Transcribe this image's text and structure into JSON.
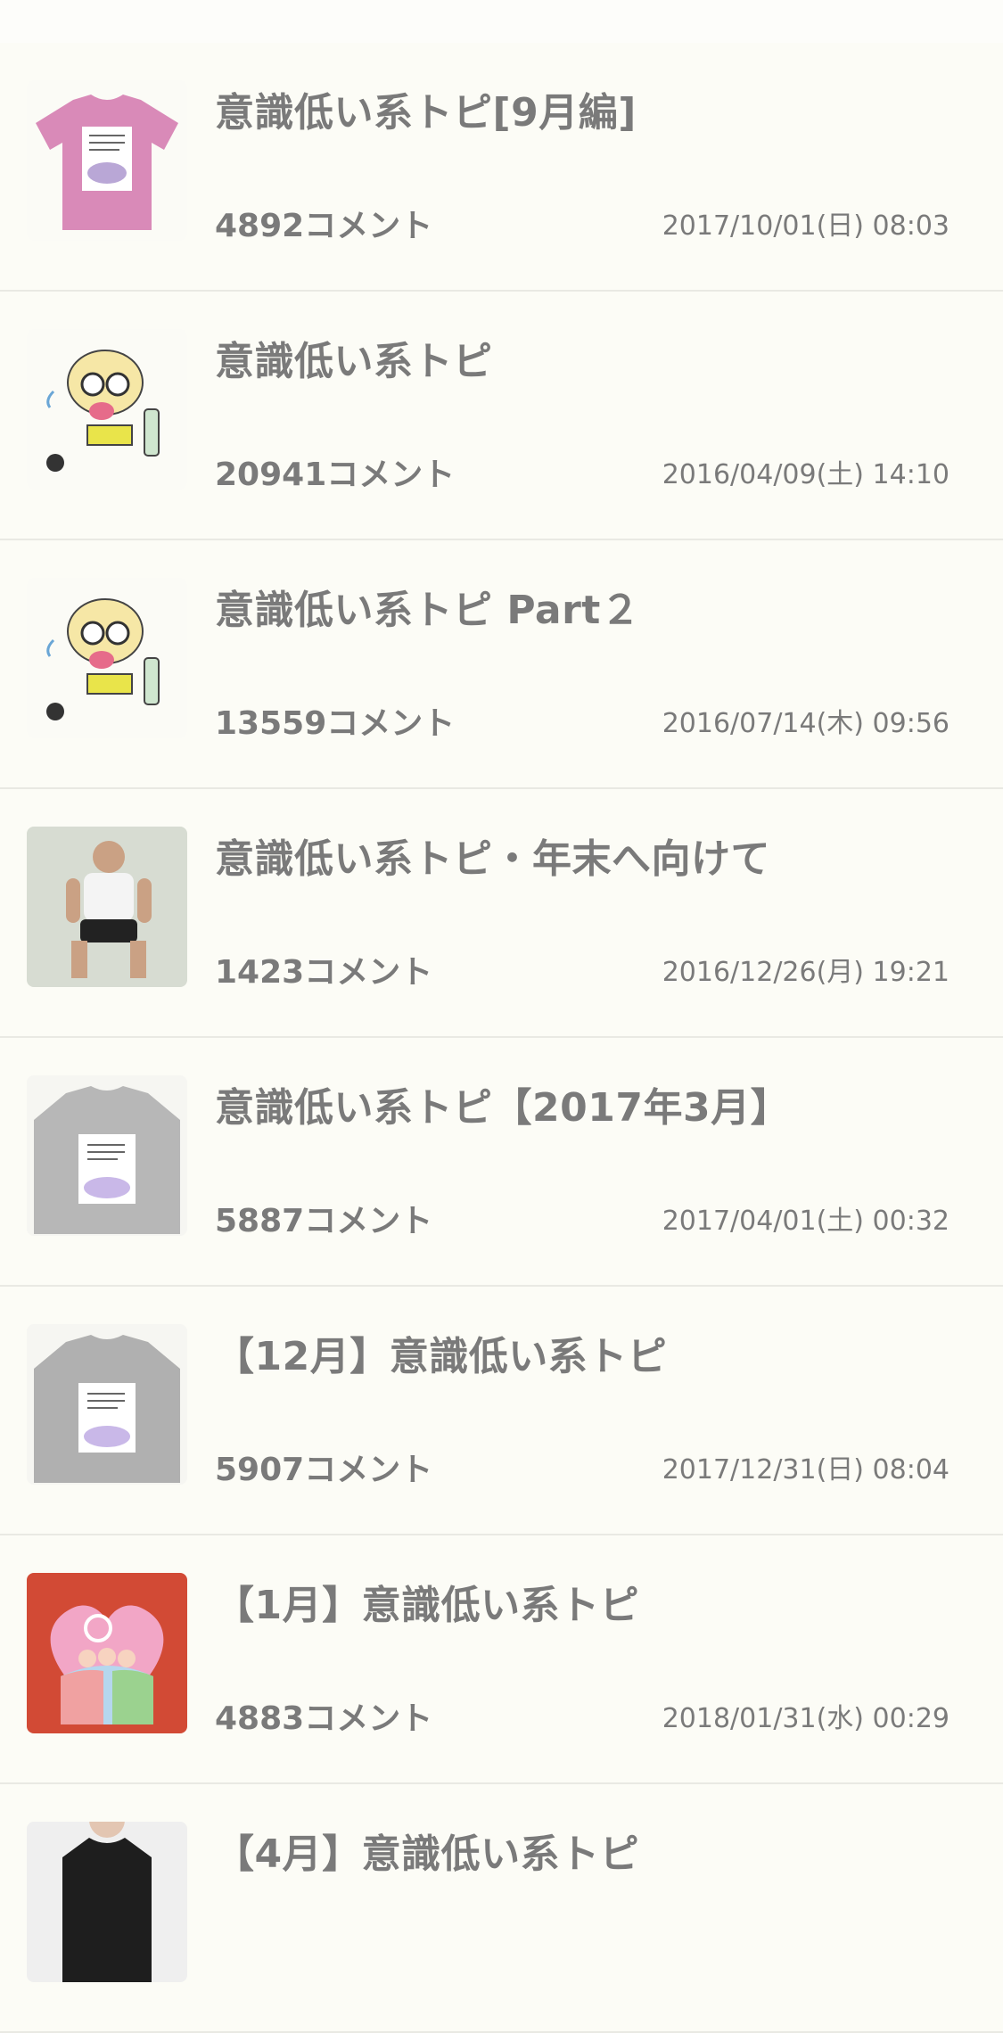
{
  "topics": [
    {
      "title": "意識低い系トピ[9月編]",
      "comments": "4892コメント",
      "date": "2017/10/01(日) 08:03",
      "thumbnail": "pink-tshirt-illustration"
    },
    {
      "title": "意識低い系トピ",
      "comments": "20941コメント",
      "date": "2016/04/09(土) 14:10",
      "thumbnail": "drunk-cartoon-character"
    },
    {
      "title": "意識低い系トピ Part２",
      "comments": "13559コメント",
      "date": "2016/07/14(木) 09:56",
      "thumbnail": "drunk-cartoon-character"
    },
    {
      "title": "意識低い系トピ・年末へ向けて",
      "comments": "1423コメント",
      "date": "2016/12/26(月) 19:21",
      "thumbnail": "man-squatting-photo"
    },
    {
      "title": "意識低い系トピ【2017年3月】",
      "comments": "5887コメント",
      "date": "2017/04/01(土) 00:32",
      "thumbnail": "gray-sweatshirt-illustration"
    },
    {
      "title": "【12月】意識低い系トピ",
      "comments": "5907コメント",
      "date": "2017/12/31(日) 08:04",
      "thumbnail": "gray-sweatshirt-illustration"
    },
    {
      "title": "【1月】意識低い系トピ",
      "comments": "4883コメント",
      "date": "2018/01/31(水) 00:29",
      "thumbnail": "heart-bed-illustration"
    },
    {
      "title": "【4月】意識低い系トピ",
      "comments": "",
      "date": "",
      "thumbnail": "woman-black-top-photo"
    }
  ]
}
